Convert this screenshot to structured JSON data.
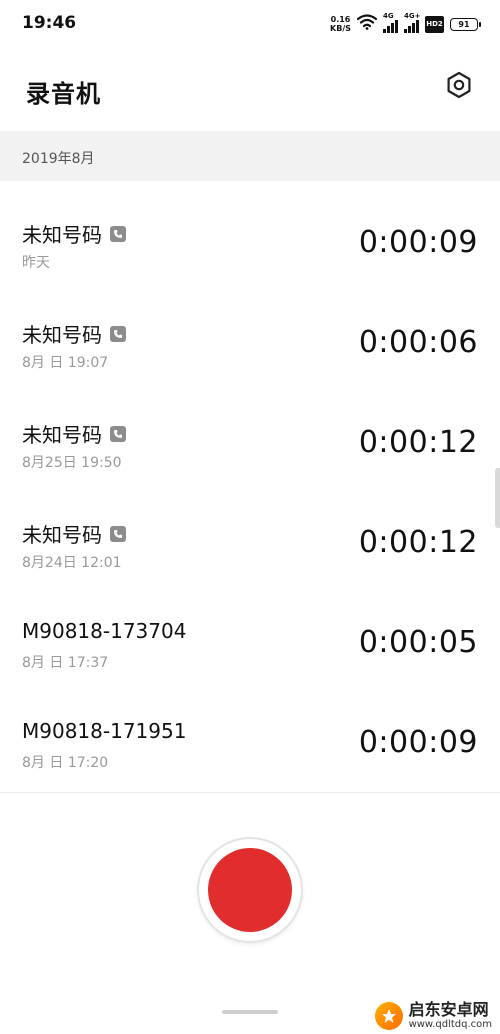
{
  "status_bar": {
    "time": "19:46",
    "net_speed_value": "0.16",
    "net_speed_unit": "KB/S",
    "signal1_tag": "4G",
    "signal2_tag": "4G+",
    "hd_label": "HD2",
    "battery": "91"
  },
  "app_bar": {
    "title": "录音机",
    "settings_icon": "gear-icon"
  },
  "section": {
    "month": "2019年8月"
  },
  "recordings": [
    {
      "name": "未知号码",
      "is_call": true,
      "date": "昨天",
      "duration": "0:00:09"
    },
    {
      "name": "未知号码",
      "is_call": true,
      "date": "8月  日 19:07",
      "duration": "0:00:06"
    },
    {
      "name": "未知号码",
      "is_call": true,
      "date": "8月25日 19:50",
      "duration": "0:00:12"
    },
    {
      "name": "未知号码",
      "is_call": true,
      "date": "8月24日 12:01",
      "duration": "0:00:12"
    },
    {
      "name": "M90818-173704",
      "is_call": false,
      "date": "8月  日 17:37",
      "duration": "0:00:05"
    },
    {
      "name": "M90818-171951",
      "is_call": false,
      "date": "8月  日 17:20",
      "duration": "0:00:09"
    }
  ],
  "colors": {
    "record_red": "#e12d2d",
    "section_bg": "#f2f2f2",
    "call_badge": "#8c8c8c"
  },
  "watermark": {
    "title": "启东安卓网",
    "url": "www.qdltdq.com"
  }
}
